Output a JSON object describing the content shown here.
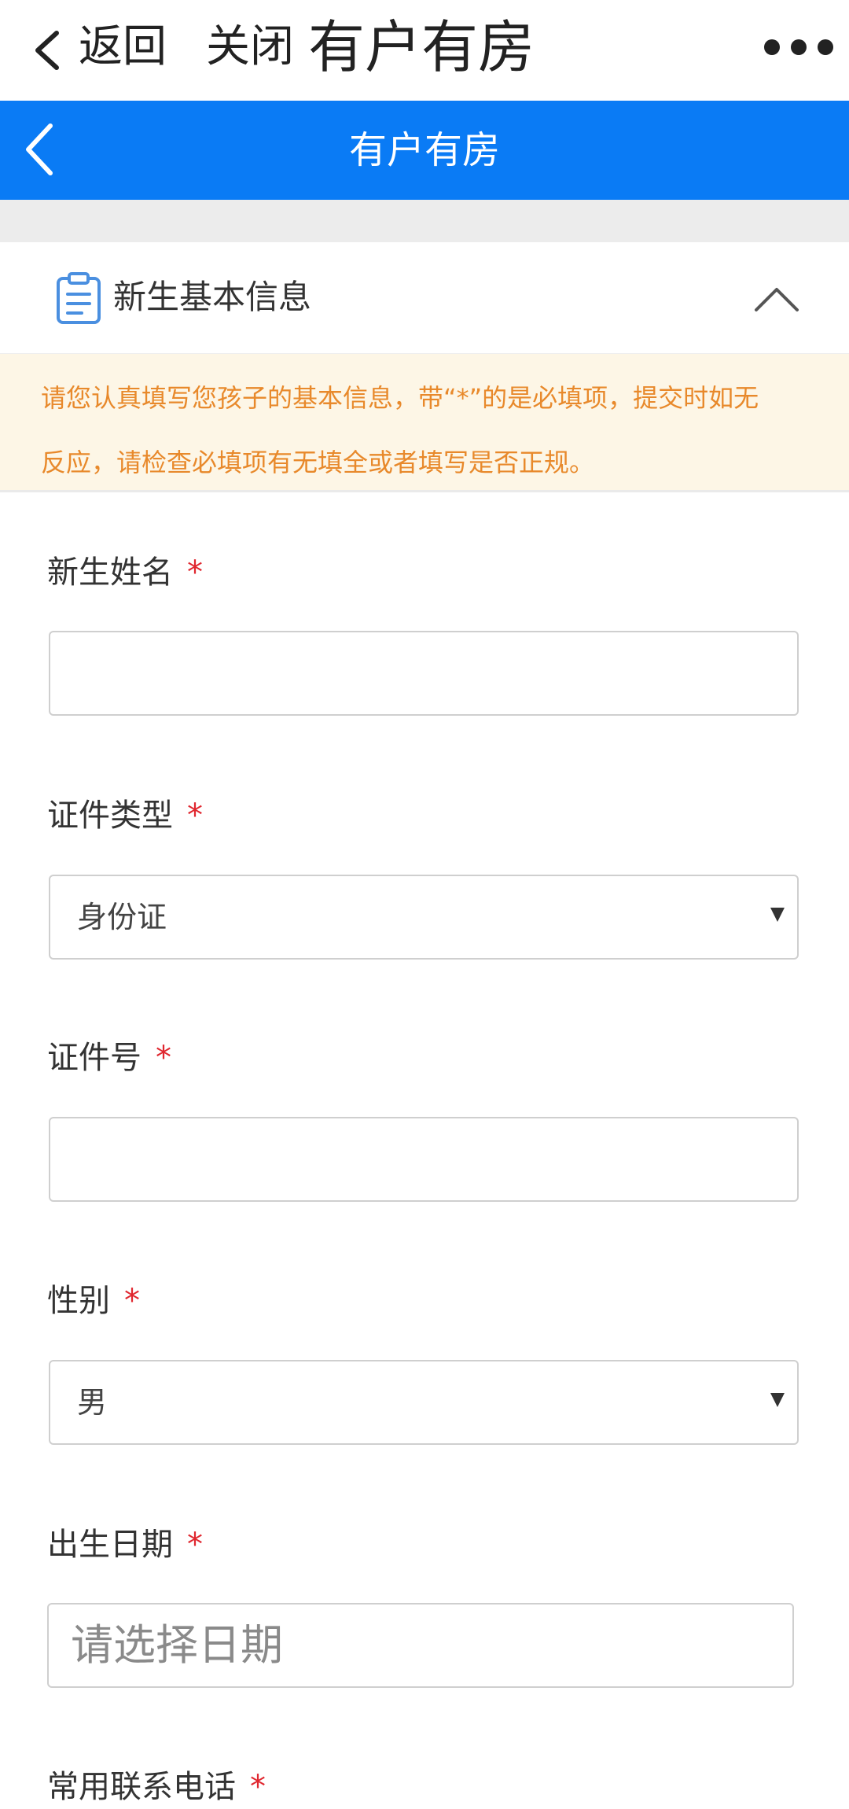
{
  "top_bar": {
    "back_label": "返回",
    "close_label": "关闭",
    "title": "有户有房"
  },
  "nav_bar": {
    "title": "有户有房",
    "color": "#0a7bf5"
  },
  "section": {
    "title": "新生基本信息",
    "icon": "clipboard-icon",
    "collapse_icon": "chevron-up-icon"
  },
  "notice": {
    "line1": "请您认真填写您孩子的基本信息，带“*”的是必填项，提交时如无",
    "line2": "反应，请检查必填项有无填全或者填写是否正规。",
    "color": "#e8892b"
  },
  "form": {
    "required_mark": "*",
    "name": {
      "label": "新生姓名",
      "value": ""
    },
    "id_type": {
      "label": "证件类型",
      "value": "身份证"
    },
    "id_number": {
      "label": "证件号",
      "value": ""
    },
    "gender": {
      "label": "性别",
      "value": "男"
    },
    "birth_date": {
      "label": "出生日期",
      "placeholder": "请选择日期"
    },
    "phone": {
      "label": "常用联系电话"
    }
  }
}
